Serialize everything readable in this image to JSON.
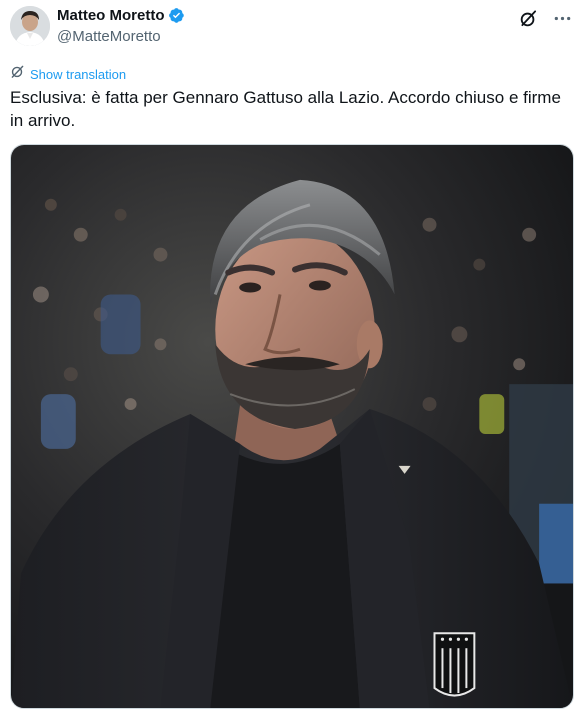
{
  "author": {
    "display_name": "Matteo Moretto",
    "handle": "@MatteMoretto",
    "verified": true,
    "verified_icon": "verified-badge-icon",
    "accent_color": "#1d9bf0"
  },
  "actions": {
    "grok_icon": "grok-icon",
    "more_icon": "more-options-icon"
  },
  "translation": {
    "label": "Show translation",
    "icon": "translate-icon"
  },
  "tweet": {
    "text": "Esclusiva: è fatta per Gennaro Gattuso alla Lazio. Accordo chiuso e firme in arrivo."
  },
  "media": {
    "type": "photo",
    "icon": "media-photo"
  }
}
